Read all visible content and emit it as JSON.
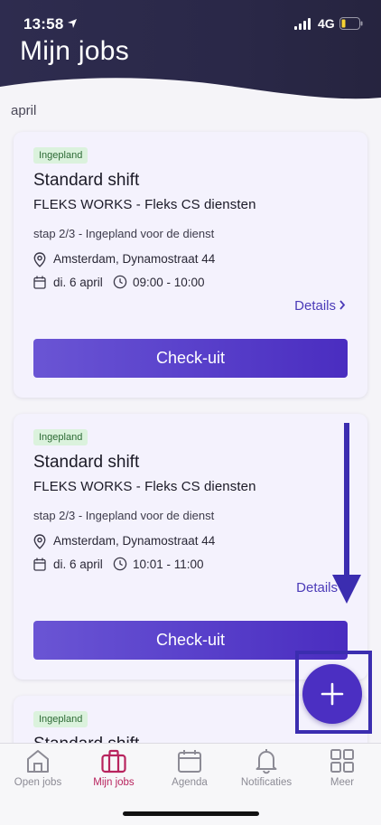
{
  "status_bar": {
    "time": "13:58",
    "network": "4G"
  },
  "page": {
    "title": "Mijn jobs",
    "month": "april"
  },
  "jobs": [
    {
      "badge": "Ingepland",
      "title": "Standard shift",
      "company": "FLEKS WORKS - Fleks CS diensten",
      "step": "stap 2/3 - Ingepland voor de dienst",
      "location": "Amsterdam, Dynamostraat 44",
      "date": "di. 6 april",
      "time": "09:00 - 10:00",
      "details_label": "Details",
      "button_label": "Check-uit"
    },
    {
      "badge": "Ingepland",
      "title": "Standard shift",
      "company": "FLEKS WORKS - Fleks CS diensten",
      "step": "stap 2/3 - Ingepland voor de dienst",
      "location": "Amsterdam, Dynamostraat 44",
      "date": "di. 6 april",
      "time": "10:01 - 11:00",
      "details_label": "Details",
      "button_label": "Check-uit"
    },
    {
      "badge": "Ingepland",
      "title": "Standard shift"
    }
  ],
  "fab": {
    "icon": "plus-icon"
  },
  "bottom_nav": {
    "items": [
      {
        "label": "Open jobs",
        "icon": "home-icon",
        "active": false
      },
      {
        "label": "Mijn jobs",
        "icon": "briefcase-icon",
        "active": true
      },
      {
        "label": "Agenda",
        "icon": "calendar-icon",
        "active": false
      },
      {
        "label": "Notificaties",
        "icon": "bell-icon",
        "active": false
      },
      {
        "label": "Meer",
        "icon": "grid-icon",
        "active": false
      }
    ]
  },
  "colors": {
    "header_bg": "#2e2c4f",
    "accent": "#4b2fc2",
    "active_nav": "#b8245e",
    "badge_bg": "#dbf2dd",
    "annotation": "#3b2db0"
  }
}
